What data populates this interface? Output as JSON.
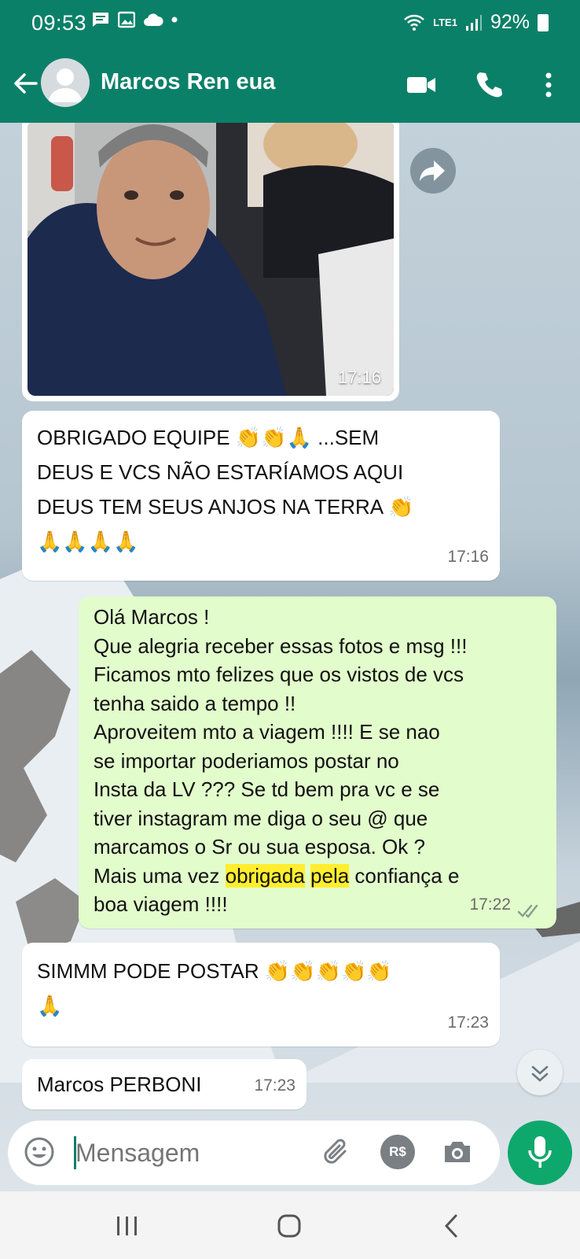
{
  "status_bar": {
    "time": "09:53",
    "battery": "92%",
    "network": "LTE1"
  },
  "header": {
    "contact_name": "Marcos Ren eua"
  },
  "messages": [
    {
      "id": "photo",
      "time": "17:16"
    },
    {
      "id": "m1",
      "direction": "in",
      "text": "OBRIGADO EQUIPE 👏👏🙏 ...SEM\nDEUS E VCS NÃO ESTARÍAMOS AQUI\nDEUS TEM SEUS ANJOS NA TERRA 👏\n🙏🙏🙏🙏",
      "time": "17:16"
    },
    {
      "id": "m2",
      "direction": "out",
      "text_before": "Olá Marcos !\nQue alegria receber essas fotos e msg !!!\nFicamos mto felizes que os vistos de vcs\ntenha saido a tempo !!\nAproveitem mto a viagem !!!! E se nao\nse importar poderiamos postar no\nInsta da LV ??? Se td bem pra vc e se\ntiver instagram me diga o seu @ que\nmarcamos o Sr ou sua esposa. Ok ?\nMais uma vez ",
      "highlight_1": "obrigada",
      "between": " ",
      "highlight_2": "pela",
      "text_after": " confiança e\nboa viagem !!!!",
      "time": "17:22"
    },
    {
      "id": "m3",
      "direction": "in",
      "text": "SIMMM PODE POSTAR 👏👏👏👏👏\n🙏",
      "time": "17:23"
    },
    {
      "id": "m4",
      "direction": "in",
      "text": "Marcos PERBONI",
      "time": "17:23"
    }
  ],
  "input": {
    "placeholder": "Mensagem"
  },
  "icons": {
    "back": "arrow-left-icon",
    "video": "video-call-icon",
    "phone": "phone-icon",
    "menu": "more-vert-icon",
    "emoji": "emoji-icon",
    "attach": "paperclip-icon",
    "payment": "payment-icon",
    "camera": "camera-icon",
    "mic": "mic-icon"
  },
  "icon_labels": {
    "payment": "R$"
  },
  "colors": {
    "brand": "#0b8068",
    "outgoing_bubble": "#e2fccc",
    "incoming_bubble": "#ffffff",
    "highlight": "#ffee2f",
    "mic_button": "#0fa86c"
  }
}
